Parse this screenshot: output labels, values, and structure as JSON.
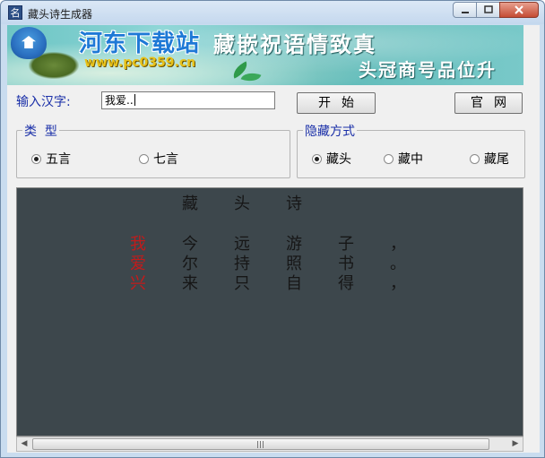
{
  "window": {
    "title": "藏头诗生成器",
    "icon_char": "名"
  },
  "banner": {
    "site_name": "河东下载站",
    "site_url": "www.pc0359.cn",
    "title": "藏嵌祝语情致真",
    "subtitle": "头冠商号品位升"
  },
  "form": {
    "input_label": "输入汉字:",
    "input_value": "我爱..",
    "start_button": "开始",
    "website_button": "官网"
  },
  "type_group": {
    "legend": "类  型",
    "options": [
      {
        "label": "五言",
        "selected": true
      },
      {
        "label": "七言",
        "selected": false
      }
    ]
  },
  "hide_group": {
    "legend": "隐藏方式",
    "options": [
      {
        "label": "藏头",
        "selected": true
      },
      {
        "label": "藏中",
        "selected": false
      },
      {
        "label": "藏尾",
        "selected": false
      }
    ]
  },
  "poem": {
    "title": [
      "藏",
      "头",
      "诗"
    ],
    "lines": [
      [
        "我",
        "今",
        "远",
        "游",
        "子",
        "，"
      ],
      [
        "爱",
        "尔",
        "持",
        "照",
        "书",
        "。"
      ],
      [
        "兴",
        "来",
        "只",
        "自",
        "得",
        "，"
      ]
    ],
    "highlight_color": "#c21b1b",
    "background_color": "#3d474c"
  }
}
